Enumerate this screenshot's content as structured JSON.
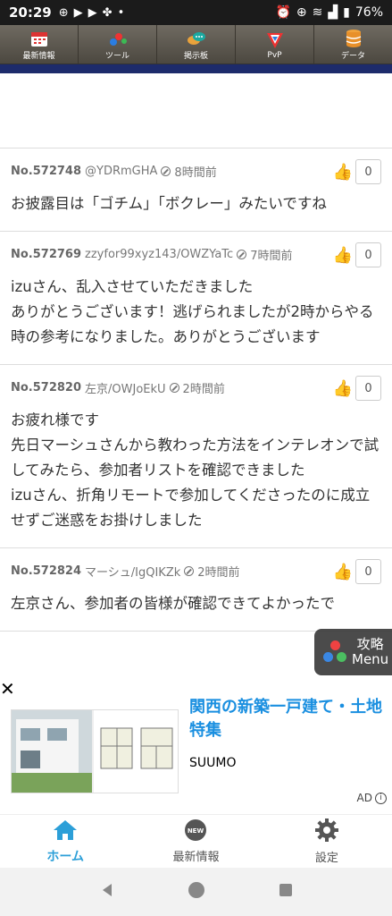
{
  "status_bar": {
    "time": "20:29",
    "battery": "76%",
    "left_icons": [
      "app-badge-icon",
      "youtube-icon",
      "youtube-icon",
      "pinwheel-icon",
      "dot-icon"
    ],
    "right_icons": [
      "alarm-icon",
      "data-saver-icon",
      "wifi-icon",
      "signal-icon",
      "battery-icon"
    ]
  },
  "top_nav": {
    "items": [
      {
        "label": "最新情報",
        "icon": "calendar-icon"
      },
      {
        "label": "ツール",
        "icon": "tool-icon"
      },
      {
        "label": "掲示板",
        "icon": "chat-icon"
      },
      {
        "label": "PvP",
        "icon": "pvp-icon"
      },
      {
        "label": "データ",
        "icon": "database-icon"
      }
    ]
  },
  "posts": [
    {
      "no": "No.572748",
      "user": "@YDRmGHA",
      "time": "8時間前",
      "likes": "0",
      "lines": [
        "お披露目は「ゴチム」「ボクレー」みたいですね"
      ]
    },
    {
      "no": "No.572769",
      "user": "zzyfor99xyz143/OWZYaTc",
      "time": "7時間前",
      "likes": "0",
      "lines": [
        "izuさん、乱入させていただきました",
        "ありがとうございます！逃げられましたが2時からやる時の参考になりました。ありがとうございます"
      ]
    },
    {
      "no": "No.572820",
      "user": "左京/OWJoEkU",
      "time": "2時間前",
      "likes": "0",
      "lines": [
        "お疲れ様です",
        "先日マーシュさんから教わった方法をインテレオンで試してみたら、参加者リストを確認できました",
        "izuさん、折角リモートで参加してくださったのに成立せずご迷惑をお掛けしました"
      ]
    },
    {
      "no": "No.572824",
      "user": "マーシュ/IgQIKZk",
      "time": "2時間前",
      "likes": "0",
      "lines": [
        "左京さん、参加者の皆様が確認できてよかったで"
      ]
    }
  ],
  "menu_button": {
    "line1": "攻略",
    "line2": "Menu"
  },
  "ad": {
    "close": "✕",
    "title": "関西の新築一戸建て・土地特集",
    "brand": "SUUMO",
    "label": "AD",
    "info": "i"
  },
  "tab_bar": {
    "items": [
      {
        "label": "ホーム",
        "icon": "home-icon",
        "active": true
      },
      {
        "label": "最新情報",
        "icon": "new-badge-icon",
        "badge": "NEW",
        "active": false
      },
      {
        "label": "設定",
        "icon": "gear-icon",
        "active": false
      }
    ]
  },
  "colors": {
    "accent": "#2c9fd8",
    "nav_bg": "#5e5950",
    "navy": "#1d2b6b",
    "ad_title": "#1a8fe0"
  }
}
